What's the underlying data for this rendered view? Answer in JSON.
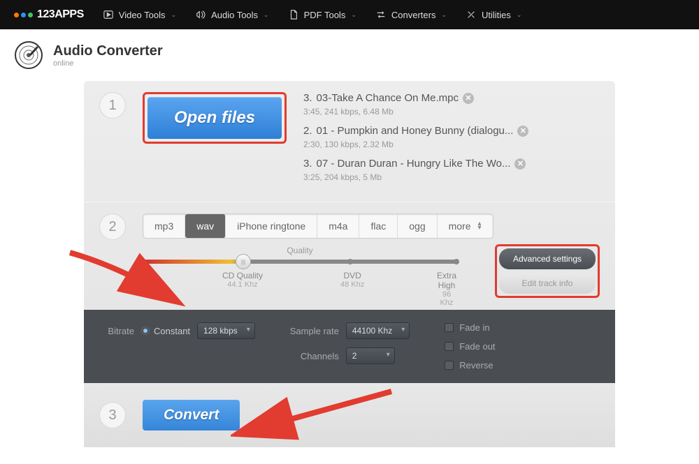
{
  "topbar": {
    "brand": "123APPS",
    "items": [
      {
        "label": "Video Tools"
      },
      {
        "label": "Audio Tools"
      },
      {
        "label": "PDF Tools"
      },
      {
        "label": "Converters"
      },
      {
        "label": "Utilities"
      }
    ]
  },
  "header": {
    "title": "Audio Converter",
    "subtitle": "online"
  },
  "step1": {
    "number": "1",
    "open_button": "Open files",
    "files": [
      {
        "index": "3.",
        "name": "03-Take A Chance On Me.mpc",
        "meta": "3:45, 241 kbps, 6.48 Mb"
      },
      {
        "index": "2.",
        "name": "01 - Pumpkin and Honey Bunny (dialogu...",
        "meta": "2:30, 130 kbps, 2.32 Mb"
      },
      {
        "index": "3.",
        "name": "07 - Duran Duran - Hungry Like The Wo...",
        "meta": "3:25, 204 kbps, 5 Mb"
      }
    ]
  },
  "step2": {
    "number": "2",
    "formats": [
      "mp3",
      "wav",
      "iPhone ringtone",
      "m4a",
      "flac",
      "ogg",
      "more"
    ],
    "active": "wav",
    "quality": {
      "label": "Quality",
      "labels": [
        {
          "t": "Tape",
          "s": "20 Khz"
        },
        {
          "t": "CD Quality",
          "s": "44.1 Khz"
        },
        {
          "t": "DVD",
          "s": "48 Khz"
        },
        {
          "t": "Extra High",
          "s": "96 Khz"
        }
      ]
    },
    "side": {
      "advanced": "Advanced settings",
      "edit_info": "Edit track info"
    }
  },
  "advanced": {
    "bitrate_label": "Bitrate",
    "bitrate_mode": "Constant",
    "bitrate_value": "128 kbps",
    "sample_label": "Sample rate",
    "sample_value": "44100 Khz",
    "channels_label": "Channels",
    "channels_value": "2",
    "fade_in": "Fade in",
    "fade_out": "Fade out",
    "reverse": "Reverse"
  },
  "step3": {
    "number": "3",
    "convert": "Convert"
  }
}
